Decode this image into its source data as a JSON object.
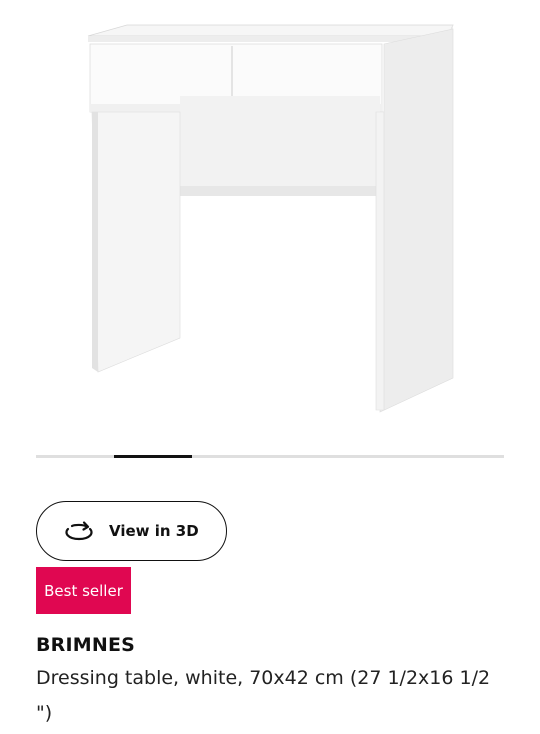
{
  "product": {
    "name": "BRIMNES",
    "description": "Dressing table, white, 70x42 cm (27 1/2x16 1/2 \")",
    "badge": "Best seller",
    "view_3d_label": "View in 3D",
    "image_subject": "white dressing table"
  },
  "carousel": {
    "slide_count": 6,
    "active_slide": 2
  },
  "colors": {
    "badge_background": "#e00751",
    "indicator_active": "#111111",
    "indicator_track": "#dfdfdf",
    "text_primary": "#111111"
  },
  "icons": {
    "view_3d": "rotate-3d-icon"
  }
}
